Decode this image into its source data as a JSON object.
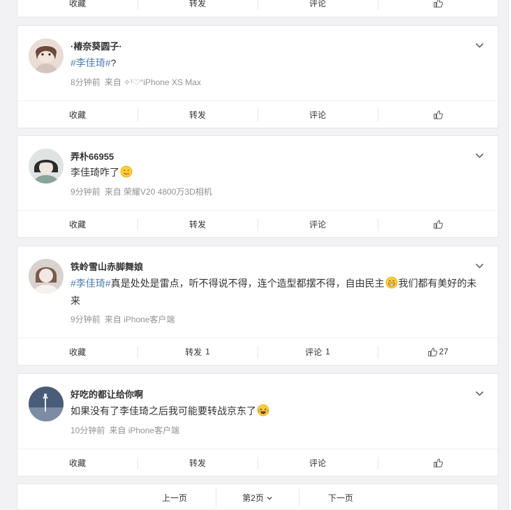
{
  "posts": [
    {
      "username": "",
      "segments": [],
      "time": "",
      "source": "",
      "actions": {
        "collect": "收藏",
        "repost": "转发",
        "repost_count": "",
        "comment": "评论",
        "comment_count": "",
        "like_count": ""
      }
    },
    {
      "username": "·椿奈葵圆子·",
      "hashtag": "#李佳琦#",
      "text_after": "?",
      "time": "8分钟前",
      "source": "来自 ✧ᵗ♡°iPhone XS Max",
      "actions": {
        "collect": "收藏",
        "repost": "转发",
        "repost_count": "",
        "comment": "评论",
        "comment_count": "",
        "like_count": ""
      }
    },
    {
      "username": "弄朴66955",
      "text_before": "李佳琦咋了",
      "emoji": "yummy-face",
      "time": "9分钟前",
      "source": "来自 荣耀V20 4800万3D相机",
      "actions": {
        "collect": "收藏",
        "repost": "转发",
        "repost_count": "",
        "comment": "评论",
        "comment_count": "",
        "like_count": ""
      }
    },
    {
      "username": "铁岭雪山赤脚舞娘",
      "hashtag": "#李佳琦#",
      "text_after": "真是处处是雷点，听不得说不得，连个造型都摆不得，自由民主",
      "emoji": "grin-face",
      "text_tail": "我们都有美好的未来",
      "time": "9分钟前",
      "source": "来自 iPhone客户端",
      "actions": {
        "collect": "收藏",
        "repost": "转发",
        "repost_count": "1",
        "comment": "评论",
        "comment_count": "1",
        "like_count": "27"
      }
    },
    {
      "username": "好吃的都让给你啊",
      "text_before": "如果没有了李佳琦之后我可能要转战京东了",
      "emoji": "laugh-tears-face",
      "time": "10分钟前",
      "source": "来自 iPhone客户端",
      "actions": {
        "collect": "收藏",
        "repost": "转发",
        "repost_count": "",
        "comment": "评论",
        "comment_count": "",
        "like_count": ""
      }
    }
  ],
  "pager": {
    "prev": "上一页",
    "current": "第2页",
    "next": "下一页"
  },
  "colors": {
    "hashtag": "#507daf",
    "meta": "#939393",
    "background": "#f2f2f5"
  }
}
